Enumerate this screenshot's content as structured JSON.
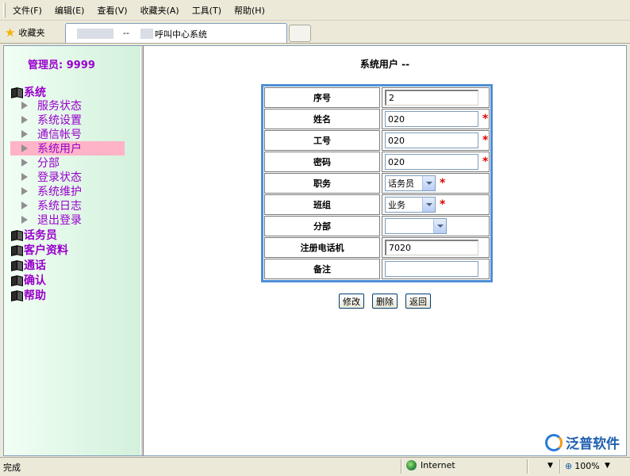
{
  "menu": [
    "文件(F)",
    "编辑(E)",
    "查看(V)",
    "收藏夹(A)",
    "工具(T)",
    "帮助(H)"
  ],
  "favorites_label": "收藏夹",
  "tab": {
    "dash": "--",
    "title": "呼叫中心系统"
  },
  "sidebar": {
    "admin": "管理员: 9999",
    "system_category": "系统",
    "system_items": [
      "服务状态",
      "系统设置",
      "通信帐号",
      "系统用户",
      "分部",
      "登录状态",
      "系统维护",
      "系统日志",
      "退出登录"
    ],
    "active_item": "系统用户",
    "other_categories": [
      "话务员",
      "客户资料",
      "通话",
      "确认",
      "帮助"
    ]
  },
  "form": {
    "title": "系统用户 --",
    "fields": {
      "seq": {
        "label": "序号",
        "value": "2"
      },
      "name": {
        "label": "姓名",
        "value": "020"
      },
      "workno": {
        "label": "工号",
        "value": "020"
      },
      "password": {
        "label": "密码",
        "value": "020"
      },
      "position": {
        "label": "职务",
        "value": "话务员"
      },
      "group": {
        "label": "班组",
        "value": "业务"
      },
      "branch": {
        "label": "分部",
        "value": ""
      },
      "phone": {
        "label": "注册电话机",
        "value": "7020"
      },
      "remark": {
        "label": "备注",
        "value": ""
      }
    },
    "required_mark": "*",
    "buttons": {
      "modify": "修改",
      "delete": "删除",
      "back": "返回"
    }
  },
  "watermark": "泛普软件",
  "status": {
    "text": "完成",
    "zone": "Internet",
    "zoom": "100%"
  },
  "colors": {
    "sidebar_text": "#9900cc",
    "active_item_bg": "#ffb3c7",
    "table_border": "#4f8fd6",
    "required": "#e00000"
  }
}
